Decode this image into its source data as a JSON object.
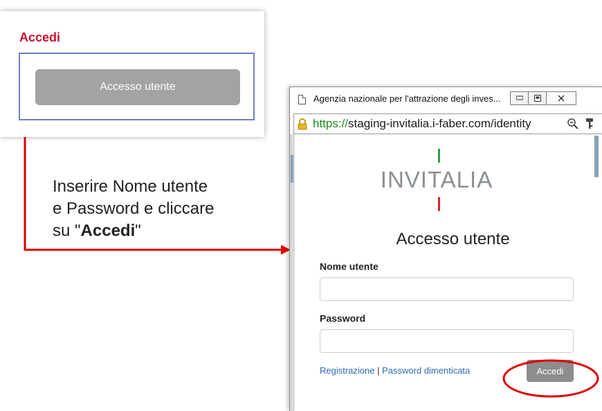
{
  "card": {
    "title": "Accedi",
    "button_label": "Accesso utente"
  },
  "instruction": {
    "line1": "Inserire Nome utente",
    "line2": "e Password e cliccare",
    "line3_prefix": "su \"",
    "line3_bold": "Accedi",
    "line3_suffix": "\""
  },
  "popup": {
    "window_title": "Agenzia nazionale per l'attrazione degli inves...",
    "url_scheme": "https://",
    "url_rest": "staging-invitalia.i-faber.com/identity",
    "logo_text": "INVITALIA",
    "form_title": "Accesso utente",
    "username_label": "Nome utente",
    "username_value": "",
    "password_label": "Password",
    "password_value": "",
    "link_registrazione": "Registrazione",
    "link_separator": " | ",
    "link_password": "Password dimenticata",
    "submit_label": "Accedi"
  },
  "colors": {
    "accent_red": "#c8102e",
    "annotation_red": "#e00000",
    "box_blue": "#6d80c6",
    "logo_green": "#2e9e4a",
    "url_green": "#1a8c1a",
    "link_blue": "#2a6ab3"
  },
  "icons": [
    "page-icon",
    "minimize-icon",
    "maximize-icon",
    "close-icon",
    "lock-icon",
    "magnifier-icon",
    "key-icon",
    "arrow-icon"
  ]
}
